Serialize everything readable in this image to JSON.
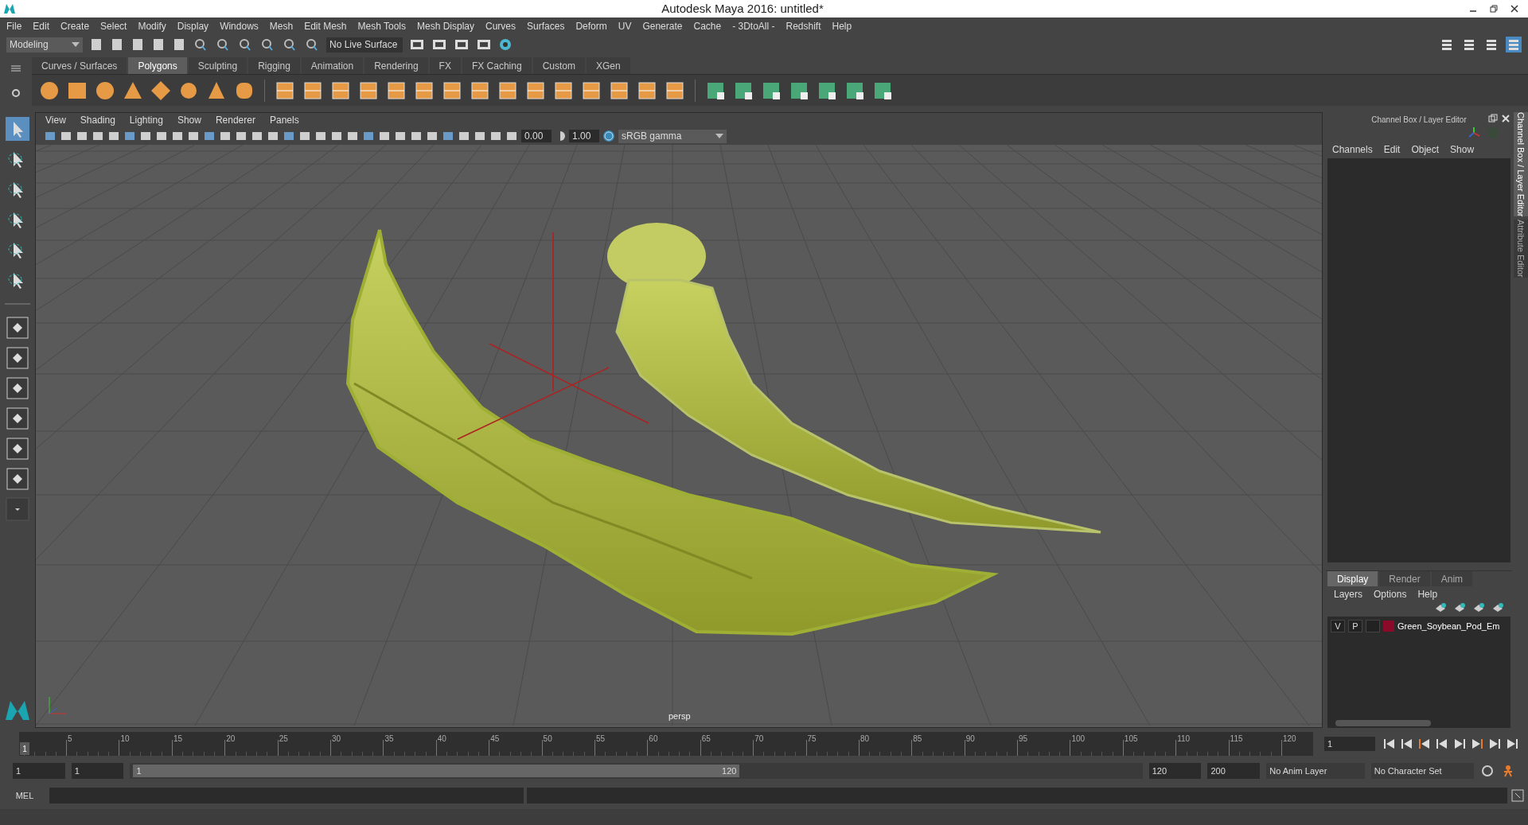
{
  "window": {
    "title": "Autodesk Maya 2016: untitled*"
  },
  "menu_bar": [
    "File",
    "Edit",
    "Create",
    "Select",
    "Modify",
    "Display",
    "Windows",
    "Mesh",
    "Edit Mesh",
    "Mesh Tools",
    "Mesh Display",
    "Curves",
    "Surfaces",
    "Deform",
    "UV",
    "Generate",
    "Cache",
    "- 3DtoAll -",
    "Redshift",
    "Help"
  ],
  "status_line": {
    "mode": "Modeling",
    "live_surface": "No Live Surface"
  },
  "shelf_tabs": [
    {
      "label": "Curves / Surfaces",
      "selected": false
    },
    {
      "label": "Polygons",
      "selected": true
    },
    {
      "label": "Sculpting",
      "selected": false
    },
    {
      "label": "Rigging",
      "selected": false
    },
    {
      "label": "Animation",
      "selected": false
    },
    {
      "label": "Rendering",
      "selected": false
    },
    {
      "label": "FX",
      "selected": false
    },
    {
      "label": "FX Caching",
      "selected": false
    },
    {
      "label": "Custom",
      "selected": false
    },
    {
      "label": "XGen",
      "selected": false
    }
  ],
  "viewport": {
    "menu": [
      "View",
      "Shading",
      "Lighting",
      "Show",
      "Renderer",
      "Panels"
    ],
    "exposure": "0.00",
    "gamma": "1.00",
    "color_space": "sRGB gamma",
    "camera": "persp"
  },
  "channel_box": {
    "title": "Channel Box / Layer Editor",
    "menu": [
      "Channels",
      "Edit",
      "Object",
      "Show"
    ],
    "layer_tabs": [
      {
        "label": "Display",
        "selected": true
      },
      {
        "label": "Render",
        "selected": false
      },
      {
        "label": "Anim",
        "selected": false
      }
    ],
    "layer_menu": [
      "Layers",
      "Options",
      "Help"
    ],
    "layers": [
      {
        "visible": "V",
        "playback": "P",
        "color": "#8b0a2a",
        "name": "Green_Soybean_Pod_Em"
      }
    ]
  },
  "side_tabs": [
    {
      "label": "Channel Box / Layer Editor",
      "selected": true
    },
    {
      "label": "Attribute Editor",
      "selected": false
    }
  ],
  "timeline": {
    "level": 0,
    "start_label": "1",
    "ticks": [
      "5",
      "10",
      "15",
      "20",
      "25",
      "30",
      "35",
      "40",
      "45",
      "50",
      "55",
      "60",
      "65",
      "70",
      "75",
      "80",
      "85",
      "90",
      "95",
      "100",
      "105",
      "110",
      "115",
      "120"
    ],
    "current_frame": "1"
  },
  "range": {
    "level": 0.6,
    "start": "1",
    "playback_start": "1",
    "slider_start": "1",
    "slider_end": "120",
    "playback_end": "120",
    "end": "200",
    "anim_layer": "No Anim Layer",
    "character_set": "No Character Set"
  },
  "command_line": {
    "label": "MEL"
  }
}
